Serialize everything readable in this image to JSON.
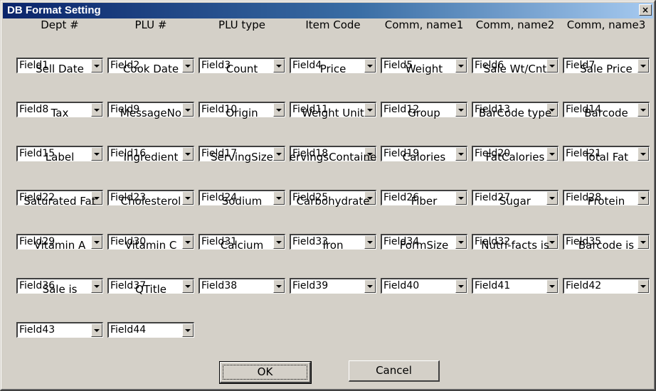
{
  "window": {
    "title": "DB Format Setting",
    "close_glyph": "×"
  },
  "fields": [
    {
      "label": "Dept #",
      "value": "Field1"
    },
    {
      "label": "PLU #",
      "value": "Field2"
    },
    {
      "label": "PLU type",
      "value": "Field3"
    },
    {
      "label": "Item Code",
      "value": "Field4"
    },
    {
      "label": "Comm, name1",
      "value": "Field5"
    },
    {
      "label": "Comm, name2",
      "value": "Field6"
    },
    {
      "label": "Comm, name3",
      "value": "Field7"
    },
    {
      "label": "Sell Date",
      "value": "Field8"
    },
    {
      "label": "Cook Date",
      "value": "Field9"
    },
    {
      "label": "Count",
      "value": "Field10"
    },
    {
      "label": "Price",
      "value": "Field11"
    },
    {
      "label": "Weight",
      "value": "Field12"
    },
    {
      "label": "Sale Wt/Cnt",
      "value": "Field13"
    },
    {
      "label": "Sale Price",
      "value": "Field14"
    },
    {
      "label": "Tax",
      "value": "Field15"
    },
    {
      "label": "MessageNo",
      "value": "Field16"
    },
    {
      "label": "Origin",
      "value": "Field17"
    },
    {
      "label": "Weight Unit",
      "value": "Field18"
    },
    {
      "label": "Group",
      "value": "Field19"
    },
    {
      "label": "BarCode type",
      "value": "Field20"
    },
    {
      "label": "Barcode",
      "value": "Field21"
    },
    {
      "label": "Label",
      "value": "Field22"
    },
    {
      "label": "Ingredient",
      "value": "Field23"
    },
    {
      "label": "ServingSize",
      "value": "Field24"
    },
    {
      "label": "ervingsContaine",
      "value": "Field25"
    },
    {
      "label": "Calories",
      "value": "Field26"
    },
    {
      "label": "FatCalories",
      "value": "Field27"
    },
    {
      "label": "Total Fat",
      "value": "Field28"
    },
    {
      "label": "Saturated Fat",
      "value": "Field29"
    },
    {
      "label": "Cholesterol",
      "value": "Field30"
    },
    {
      "label": "Sodium",
      "value": "Field31"
    },
    {
      "label": "Carbohydrate",
      "value": "Field33"
    },
    {
      "label": "Fiber",
      "value": "Field34"
    },
    {
      "label": "Sugar",
      "value": "Field32"
    },
    {
      "label": "Protein",
      "value": "Field35"
    },
    {
      "label": "Vitamin A",
      "value": "Field36"
    },
    {
      "label": "Vitamin C",
      "value": "Field37"
    },
    {
      "label": "Calcium",
      "value": "Field38"
    },
    {
      "label": "Iron",
      "value": "Field39"
    },
    {
      "label": "FormSize",
      "value": "Field40"
    },
    {
      "label": "Nutri-facts is",
      "value": "Field41"
    },
    {
      "label": "Barcode is",
      "value": "Field42"
    },
    {
      "label": "Sale is",
      "value": "Field43"
    },
    {
      "label": "QTitle",
      "value": "Field44"
    }
  ],
  "buttons": {
    "ok": "OK",
    "cancel": "Cancel"
  }
}
